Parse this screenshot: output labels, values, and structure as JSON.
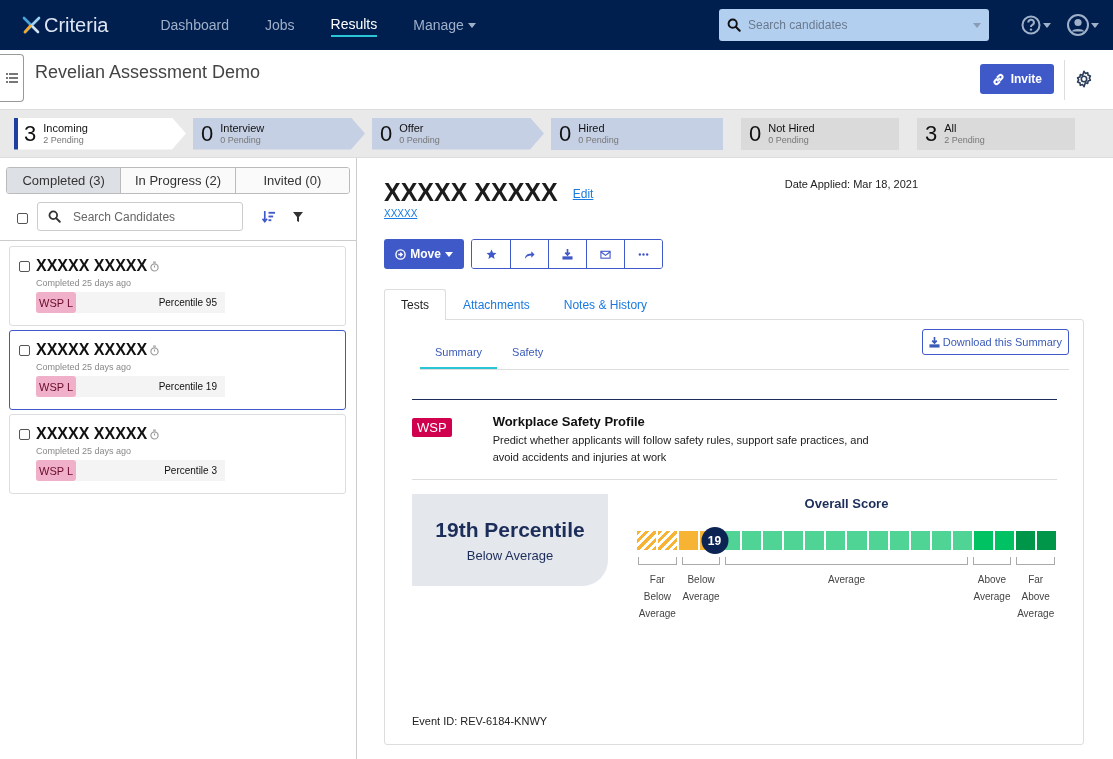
{
  "nav": {
    "logo": "Criteria",
    "links": [
      {
        "label": "Dashboard",
        "selected": false,
        "dropdown": false
      },
      {
        "label": "Jobs",
        "selected": false,
        "dropdown": false
      },
      {
        "label": "Results",
        "selected": true,
        "dropdown": false
      },
      {
        "label": "Manage",
        "selected": false,
        "dropdown": true
      }
    ],
    "search": {
      "placeholder": "Search candidates"
    }
  },
  "header": {
    "title": "Revelian Assessment Demo",
    "invite_button": "Invite"
  },
  "pipeline": [
    {
      "count": "3",
      "name": "Incoming",
      "pending": "2 Pending",
      "selected": true,
      "kind": "flow"
    },
    {
      "count": "0",
      "name": "Interview",
      "pending": "0 Pending",
      "selected": false,
      "kind": "flow"
    },
    {
      "count": "0",
      "name": "Offer",
      "pending": "0 Pending",
      "selected": false,
      "kind": "flow"
    },
    {
      "count": "0",
      "name": "Hired",
      "pending": "0 Pending",
      "selected": false,
      "kind": "flow"
    },
    {
      "count": "0",
      "name": "Not Hired",
      "pending": "0 Pending",
      "selected": false,
      "kind": "outcome"
    },
    {
      "count": "3",
      "name": "All",
      "pending": "2 Pending",
      "selected": false,
      "kind": "outcome"
    }
  ],
  "candidate_list": {
    "tabs": [
      {
        "label": "Completed (3)",
        "selected": true
      },
      {
        "label": "In Progress (2)",
        "selected": false
      },
      {
        "label": "Invited (0)",
        "selected": false
      }
    ],
    "select_all_checked": false,
    "search": {
      "placeholder": "Search Candidates"
    },
    "candidates": [
      {
        "name": "XXXXX XXXXX",
        "status": "Completed 25 days ago",
        "test": "WSP L",
        "score": "Percentile 95",
        "selected": false,
        "checked": false
      },
      {
        "name": "XXXXX XXXXX",
        "status": "Completed 25 days ago",
        "test": "WSP L",
        "score": "Percentile 19",
        "selected": true,
        "checked": false
      },
      {
        "name": "XXXXX XXXXX",
        "status": "Completed 25 days ago",
        "test": "WSP L",
        "score": "Percentile 3",
        "selected": false,
        "checked": false
      }
    ]
  },
  "candidate": {
    "name": "XXXXX XXXXX",
    "edit_link": "Edit",
    "email": "XXXXX",
    "date_applied": "Date Applied: Mar 18, 2021",
    "move_button": "Move",
    "tabs": [
      {
        "label": "Tests",
        "selected": true
      },
      {
        "label": "Attachments",
        "selected": false
      },
      {
        "label": "Notes & History",
        "selected": false
      }
    ],
    "report": {
      "tabs": [
        {
          "label": "Summary",
          "selected": true
        },
        {
          "label": "Safety",
          "selected": false
        }
      ],
      "download_button": "Download this Summary",
      "test_badge": "WSP",
      "test_title": "Workplace Safety Profile",
      "test_description": "Predict whether applicants will follow safety rules, support safe practices, and avoid accidents and injuries at work",
      "percentile": "19th Percentile",
      "band": "Below Average",
      "score_title": "Overall Score",
      "score_marker": {
        "label": "19",
        "level": 0.185
      },
      "score_bands": [
        {
          "label": "Far Below Average",
          "kind": "hatched",
          "cells": [
            {
              "color": "#f7b334"
            },
            {
              "color": "#f7b334"
            }
          ]
        },
        {
          "label": "Below Average",
          "kind": "solid",
          "cells": [
            {
              "color": "#f7b334"
            },
            {
              "color": "#f7b334"
            }
          ]
        },
        {
          "label": "Average",
          "kind": "solid",
          "cells": [
            {
              "color": "#4fd495"
            },
            {
              "color": "#4fd495"
            },
            {
              "color": "#4fd495"
            },
            {
              "color": "#4fd495"
            },
            {
              "color": "#4fd495"
            },
            {
              "color": "#4fd495"
            },
            {
              "color": "#4fd495"
            },
            {
              "color": "#4fd495"
            },
            {
              "color": "#4fd495"
            },
            {
              "color": "#4fd495"
            },
            {
              "color": "#4fd495"
            },
            {
              "color": "#4fd495"
            }
          ]
        },
        {
          "label": "Above Average",
          "kind": "solid",
          "cells": [
            {
              "color": "#00c263"
            },
            {
              "color": "#00c263"
            }
          ]
        },
        {
          "label": "Far Above Average",
          "kind": "solid",
          "cells": [
            {
              "color": "#00964a"
            },
            {
              "color": "#00964a"
            }
          ]
        }
      ],
      "event_id": "Event ID: REV-6184-KNWY"
    }
  }
}
